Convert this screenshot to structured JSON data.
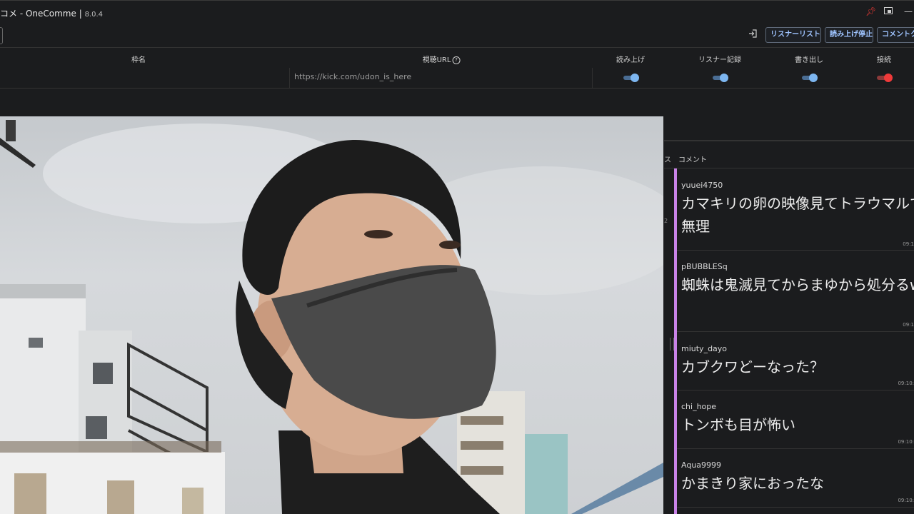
{
  "window": {
    "title": "コメ - OneComme |",
    "version": "8.0.4"
  },
  "toolbar": {
    "listener_list_label": "リスナーリスト",
    "stop_reading_label": "読み上げ停止",
    "comment_label": "コメントク"
  },
  "table": {
    "headers": {
      "frame_name": "枠名",
      "viewing_url": "視聴URL",
      "read_aloud": "読み上げ",
      "listener_record": "リスナー記録",
      "export": "書き出し",
      "connect": "接続"
    },
    "row": {
      "url": "https://kick.com/udon_is_here",
      "read_aloud": true,
      "listener_record": true,
      "export": true,
      "connect": true
    }
  },
  "colors": {
    "accent": "#c983e8",
    "toggle_on": "#7db6f0",
    "connect_on": "#f03a3a",
    "button_text": "#9fc4ff"
  },
  "comments_panel": {
    "column_x": "ス",
    "title": "コメント",
    "side_number": "2",
    "comments": [
      {
        "name": "yuuei4750",
        "text": "カマキリの卵の映像見てトラウマルで無理",
        "time": "09:1"
      },
      {
        "name": "pBUBBLESq",
        "text": "蜘蛛は鬼滅見てからまゆから処分るw",
        "time": "09:1"
      },
      {
        "name": "miuty_dayo",
        "text": "カブクワどーなった？",
        "time": "09:10:"
      },
      {
        "name": "chi_hope",
        "text": "トンボも目が怖い",
        "time": "09:10:"
      },
      {
        "name": "Aqua9999",
        "text": "かまきり家におったな",
        "time": "09:10:"
      }
    ]
  }
}
